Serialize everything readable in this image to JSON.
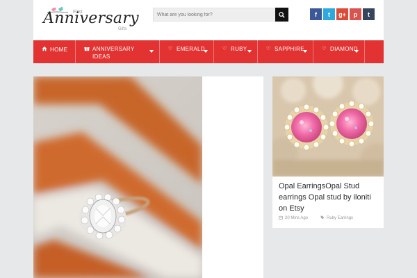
{
  "site": {
    "logo_main": "Anniversary",
    "logo_first": "First",
    "logo_gifts": "Gifts"
  },
  "search": {
    "placeholder": "What are you looking for?",
    "icon": "search-icon"
  },
  "social": [
    {
      "name": "facebook",
      "glyph": "f",
      "color": "#3b5998"
    },
    {
      "name": "twitter",
      "glyph": "t",
      "color": "#2fa8e0"
    },
    {
      "name": "google-plus",
      "glyph": "g+",
      "color": "#dd4b39"
    },
    {
      "name": "pinterest",
      "glyph": "p",
      "color": "#d9534f"
    },
    {
      "name": "tumblr",
      "glyph": "t",
      "color": "#35465c"
    }
  ],
  "nav": {
    "items": [
      {
        "label": "HOME",
        "icon": "home-icon"
      },
      {
        "label": "ANNIVERSARY IDEAS",
        "icon": "gift-icon"
      },
      {
        "label": "EMERALD",
        "icon": "heart-icon"
      },
      {
        "label": "RUBY",
        "icon": "heart-icon"
      },
      {
        "label": "SAPPHIRE",
        "icon": "heart-icon"
      },
      {
        "label": "DIAMOND",
        "icon": "heart-icon"
      }
    ],
    "color": "#e23232"
  },
  "card": {
    "title": "Opal EarringsOpal Stud earrings Opal stud by iloniti on Etsy",
    "time": "20 Mins Ago",
    "tag": "Ruby Earrings"
  }
}
